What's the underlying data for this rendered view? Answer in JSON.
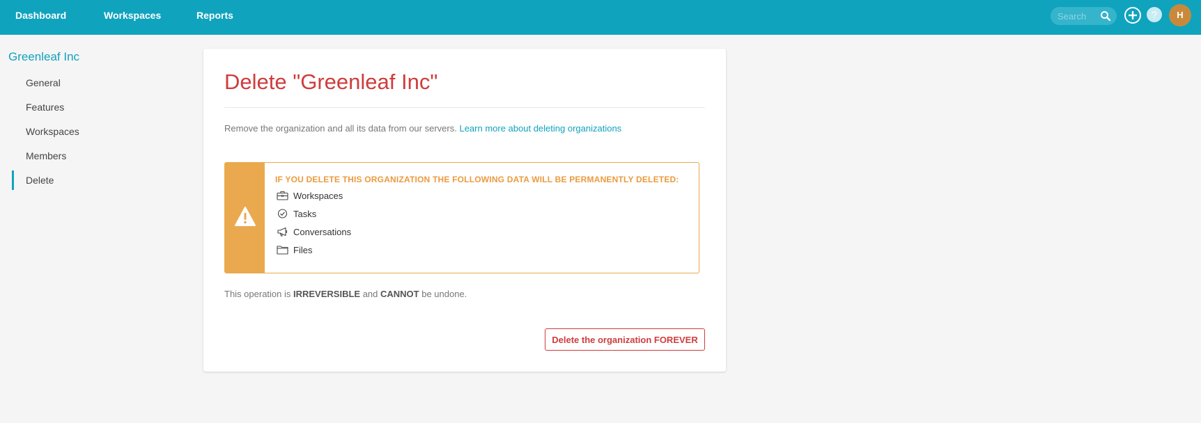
{
  "topbar": {
    "nav": [
      "Dashboard",
      "Workspaces",
      "Reports"
    ],
    "search_placeholder": "Search",
    "help_label": "?",
    "avatar_initial": "H"
  },
  "sidebar": {
    "org_name": "Greenleaf Inc",
    "items": [
      {
        "label": "General"
      },
      {
        "label": "Features"
      },
      {
        "label": "Workspaces"
      },
      {
        "label": "Members"
      },
      {
        "label": "Delete",
        "active": true
      }
    ]
  },
  "main": {
    "title": "Delete \"Greenleaf Inc\"",
    "description": "Remove the organization and all its data from our servers.",
    "learn_more": "Learn more about deleting organizations",
    "warning": {
      "heading_prefix": "IF YOU DELETE THIS ORGANIZATION THE FOLLOWING DATA ",
      "heading_emphasis": "WILL BE PERMANENTLY DELETED:",
      "items": [
        {
          "label": "Workspaces",
          "icon": "briefcase-icon"
        },
        {
          "label": "Tasks",
          "icon": "check-circle-icon"
        },
        {
          "label": "Conversations",
          "icon": "megaphone-icon"
        },
        {
          "label": "Files",
          "icon": "folder-icon"
        }
      ]
    },
    "irreversible": {
      "prefix": "This operation is ",
      "word1": "IRREVERSIBLE",
      "middle": " and ",
      "word2": "CANNOT",
      "suffix": " be undone."
    },
    "delete_button": "Delete the organization FOREVER"
  },
  "colors": {
    "brand": "#10a3be",
    "danger": "#cf3c3c",
    "warning": "#eaa94f",
    "background": "#f5f5f5"
  }
}
